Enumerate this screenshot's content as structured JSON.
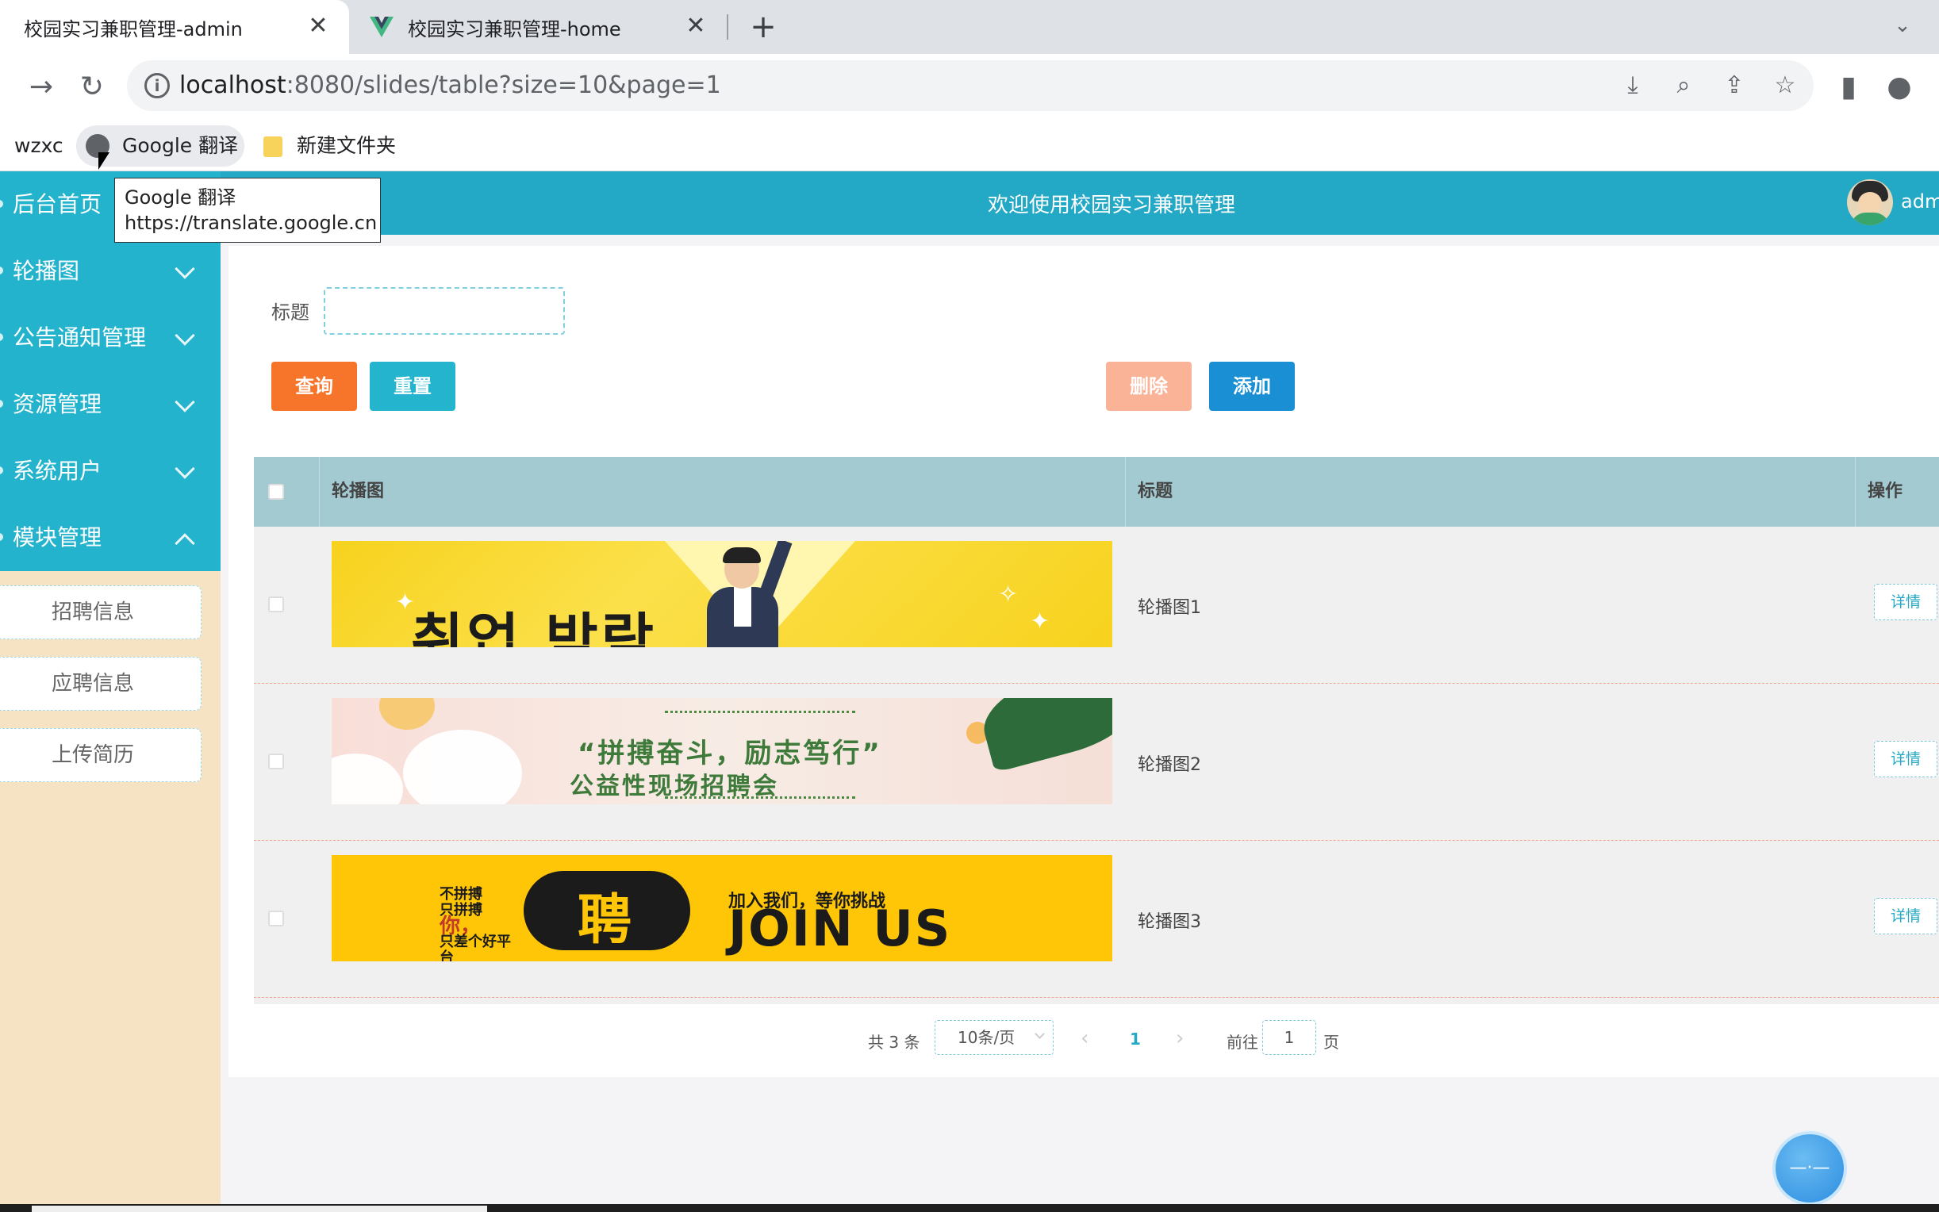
{
  "browser": {
    "tabs": [
      {
        "title": "校园实习兼职管理-admin",
        "active": true
      },
      {
        "title": "校园实习兼职管理-home",
        "active": false
      }
    ],
    "url_host": "localhost",
    "url_rest": ":8080/slides/table?size=10&page=1",
    "bookmarks": [
      "wzxc",
      "Google 翻译",
      "新建文件夹"
    ],
    "tooltip": {
      "line1": "Google 翻译",
      "line2": "https://translate.google.cn"
    }
  },
  "header": {
    "welcome": "欢迎使用校园实习兼职管理",
    "user": "admi"
  },
  "sidebar": {
    "items": [
      {
        "label": "后台首页"
      },
      {
        "label": "轮播图"
      },
      {
        "label": "公告通知管理"
      },
      {
        "label": "资源管理"
      },
      {
        "label": "系统用户"
      },
      {
        "label": "模块管理"
      }
    ],
    "submenu": [
      "招聘信息",
      "应聘信息",
      "上传简历"
    ]
  },
  "search": {
    "label": "标题",
    "value": ""
  },
  "buttons": {
    "query": "查询",
    "reset": "重置",
    "delete": "删除",
    "add": "添加"
  },
  "table": {
    "headers": {
      "image": "轮播图",
      "title": "标题",
      "action": "操作"
    },
    "rows": [
      {
        "title": "轮播图1",
        "action": "详情",
        "banner_text": "취업 박람"
      },
      {
        "title": "轮播图2",
        "action": "详情",
        "banner_line1": "“拼搏奋斗，励志笃行”",
        "banner_line2": "公益性现场招聘会"
      },
      {
        "title": "轮播图3",
        "action": "详情",
        "banner_pin": "聘",
        "banner_join": "JOIN US",
        "banner_cn": "加入我们，等你挑战",
        "banner_small1": "不拼搏",
        "banner_small2": "只拼搏",
        "banner_small3": "你，",
        "banner_small4": "只差个好平台"
      }
    ]
  },
  "pagination": {
    "total": "共 3 条",
    "page_size": "10条/页",
    "current": "1",
    "goto": "前往",
    "page_input": "1",
    "page_suffix": "页"
  },
  "colors": {
    "header": "#23a8c6",
    "sidebar": "#f5e3c4",
    "menu": "#23b3cd",
    "table_head": "#a4cad1"
  }
}
